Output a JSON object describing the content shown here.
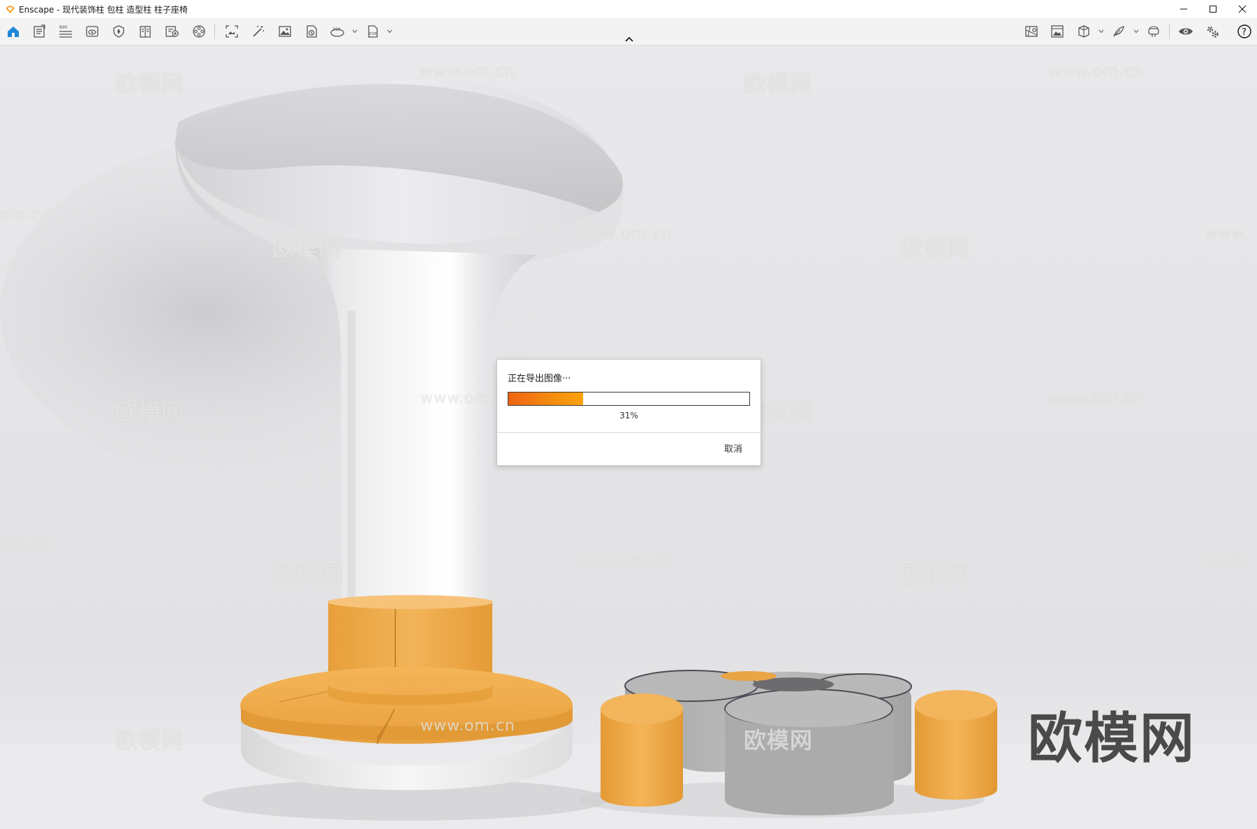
{
  "window": {
    "title": "Enscape - 现代装饰柱 包柱 造型柱 柱子座椅",
    "controls": [
      "minimize",
      "maximize",
      "close"
    ]
  },
  "toolbar": {
    "left_tools": [
      {
        "name": "home-icon",
        "active": true
      },
      {
        "name": "document-icon"
      },
      {
        "name": "bim-icon",
        "label": "BIM"
      },
      {
        "name": "view-icon"
      },
      {
        "name": "shield-icon"
      },
      {
        "name": "book-icon"
      },
      {
        "name": "asset-icon"
      },
      {
        "name": "reel-icon"
      },
      {
        "name": "screenshot-icon"
      },
      {
        "name": "magic-wand-icon"
      },
      {
        "name": "image-icon"
      },
      {
        "name": "batch-render-icon"
      },
      {
        "name": "panorama-icon",
        "label": "360",
        "dropdown": true
      },
      {
        "name": "exe-export-icon",
        "label": "EXE",
        "dropdown": true
      }
    ],
    "right_tools": [
      {
        "name": "map-icon"
      },
      {
        "name": "gallery-icon"
      },
      {
        "name": "cube-icon",
        "dropdown": true
      },
      {
        "name": "feather-icon",
        "dropdown": true
      },
      {
        "name": "vr-headset-icon"
      },
      {
        "name": "eye-icon"
      },
      {
        "name": "settings-icon"
      },
      {
        "name": "help-icon"
      }
    ],
    "accent_color": "#1e88d8"
  },
  "viewport": {
    "watermarks": [
      "欧模网",
      "www.om.cn",
      "om.cn",
      "www."
    ],
    "brand_watermark": "欧模网"
  },
  "dialog": {
    "title": "正在导出图像···",
    "progress_percent": 31,
    "progress_label": "31%",
    "cancel_label": "取消",
    "progress_colors": [
      "#ee6312",
      "#fba30c"
    ]
  }
}
